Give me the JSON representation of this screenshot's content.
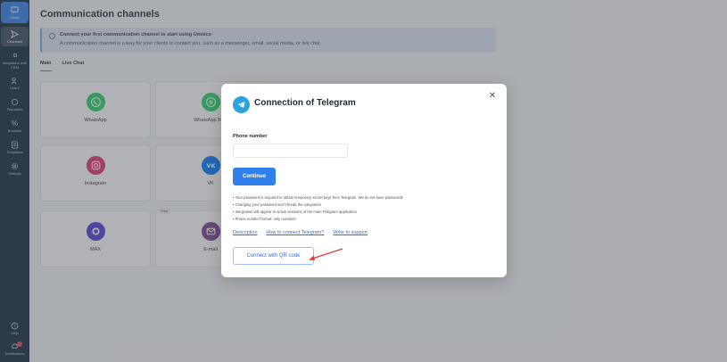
{
  "sidebar": {
    "items": [
      {
        "label": "Chats",
        "icon": "chat-icon"
      },
      {
        "label": "Channels",
        "icon": "send-icon"
      },
      {
        "label": "Integration with CRM",
        "icon": "integration-icon"
      },
      {
        "label": "Users",
        "icon": "users-icon"
      },
      {
        "label": "Payments",
        "icon": "payments-icon"
      },
      {
        "label": "Bonuses",
        "icon": "percent-icon"
      },
      {
        "label": "Templates",
        "icon": "templates-icon"
      },
      {
        "label": "Settings",
        "icon": "gear-icon"
      }
    ],
    "help_label": "Help",
    "notifications_label": "Notifications"
  },
  "page": {
    "title": "Communication channels",
    "info_title": "Connect your first communication channel to start using Umnico",
    "info_text": "A communication channel is a way for your clients to contact you, such as a messenger, email, social media, or live chat.",
    "tabs": [
      {
        "label": "Main"
      },
      {
        "label": "Live Chat"
      }
    ]
  },
  "channels": [
    {
      "label": "WhatsApp",
      "color": "#25d366"
    },
    {
      "label": "WhatsApp Busi",
      "color": "#25d366"
    },
    {
      "label": "Instagram",
      "color": "#e1306c"
    },
    {
      "label": "VK",
      "color": "#0077ff"
    },
    {
      "label": "MAX",
      "color": "#4b3bd6"
    },
    {
      "label": "E-mail",
      "color": "#7b3c8c"
    }
  ],
  "free_tag": "Free",
  "modal": {
    "title": "Connection of Telegram",
    "phone_label": "Phone number",
    "phone_value": "",
    "phone_placeholder": "",
    "continue_label": "Continue",
    "notes": [
      "Your password is required to obtain temporary secret keys from Telegram. We do not save passwords",
      "Changing your password won't break the integration",
      "Integration will appear in active sessions of the main Telegram application",
      "Phone number format: only numbers"
    ],
    "links": {
      "description": "Description",
      "how_to": "How to connect Telegram?",
      "support": "Write to support",
      "separator": "·"
    },
    "qr_label": "Connect with QR code"
  },
  "colors": {
    "accent": "#2f80ed",
    "sidebar_bg": "#12263a",
    "telegram": "#2aa3df",
    "arrow": "#e53935"
  }
}
